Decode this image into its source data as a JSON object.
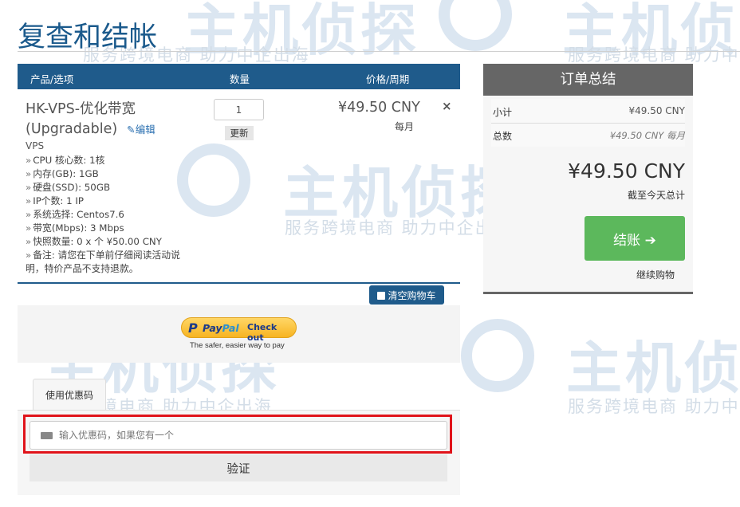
{
  "page": {
    "title": "复查和结帐"
  },
  "watermark": {
    "logo_text": "主机侦探",
    "tagline": "服务跨境电商 助力中企出海"
  },
  "cart": {
    "headers": {
      "product": "产品/选项",
      "qty": "数量",
      "price": "价格/周期"
    },
    "item": {
      "name": "HK-VPS-优化带宽",
      "name_suffix": "(Upgradable)",
      "edit_label": "编辑",
      "group": "VPS",
      "specs": [
        "CPU 核心数: 1核",
        "内存(GB): 1GB",
        "硬盘(SSD): 50GB",
        "IP个数: 1 IP",
        "系统选择: Centos7.6",
        "带宽(Mbps): 3 Mbps",
        "快照数量: 0 x 个 ¥50.00 CNY",
        "备注: 请您在下单前仔细阅读活动说明，特价产品不支持退款。"
      ],
      "quantity": "1",
      "update_label": "更新",
      "price": "¥49.50 CNY",
      "cycle": "每月",
      "remove_icon": "×"
    },
    "empty_cart_label": "清空购物车"
  },
  "paypal": {
    "p": "P",
    "pay": "Pay",
    "pal": "Pal",
    "checkout": "Check out",
    "tagline": "The safer, easier way to pay"
  },
  "promo": {
    "tab_label": "使用优惠码",
    "placeholder": "输入优惠码，如果您有一个",
    "verify_label": "验证"
  },
  "summary": {
    "title": "订单总结",
    "subtotal_label": "小计",
    "subtotal_value": "¥49.50 CNY",
    "total_label": "总数",
    "total_value": "¥49.50 CNY 每月",
    "due_today": "¥49.50 CNY",
    "due_today_label": "截至今天总计",
    "checkout_label": "结账",
    "checkout_arrow": "➔",
    "continue_label": "继续购物"
  },
  "colors": {
    "brand_blue": "#1f5b8b",
    "checkout_green": "#5cb85c",
    "highlight_red": "#e0131a",
    "summary_gray": "#666666"
  }
}
